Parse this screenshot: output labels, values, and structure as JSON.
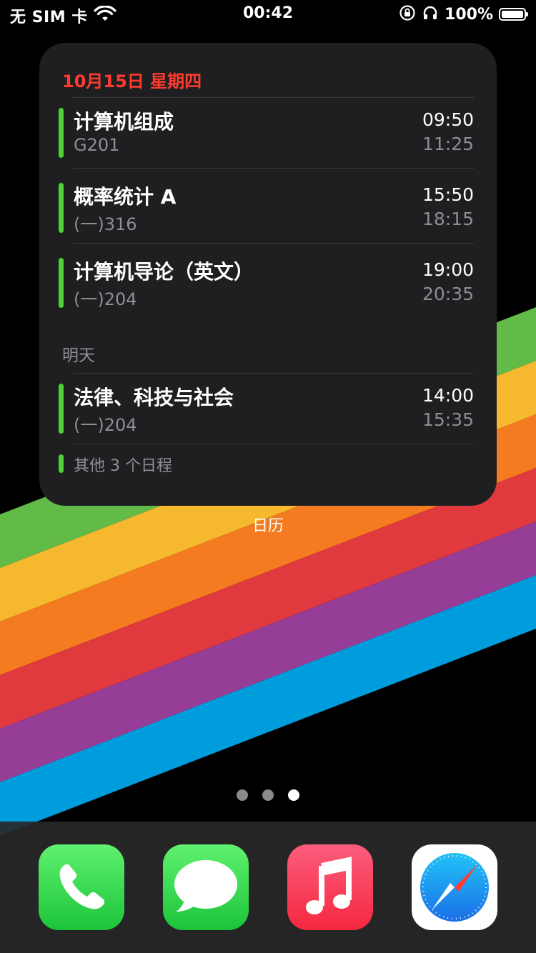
{
  "status_bar": {
    "carrier": "无 SIM 卡",
    "time": "00:42",
    "battery_percent": "100%",
    "battery_level": 1.0
  },
  "widget": {
    "app_name": "日历",
    "date_header": "10月15日 星期四",
    "today_events": [
      {
        "title": "计算机组成",
        "location": "G201",
        "start": "09:50",
        "end": "11:25"
      },
      {
        "title": "概率统计 A",
        "location": "(一)316",
        "start": "15:50",
        "end": "18:15"
      },
      {
        "title": "计算机导论（英文）",
        "location": "(一)204",
        "start": "19:00",
        "end": "20:35"
      }
    ],
    "tomorrow_label": "明天",
    "tomorrow_events": [
      {
        "title": "法律、科技与社会",
        "location": "(一)204",
        "start": "14:00",
        "end": "15:35"
      }
    ],
    "more_text": "其他 3 个日程",
    "colors": {
      "date": "#ff3b30",
      "event_bar": "#4cd137"
    }
  },
  "page_dots": {
    "count": 3,
    "active_index": 2
  },
  "dock": {
    "apps": [
      {
        "icon": "phone-icon"
      },
      {
        "icon": "messages-icon"
      },
      {
        "icon": "music-icon"
      },
      {
        "icon": "safari-icon"
      }
    ]
  },
  "wallpaper": {
    "stripe_colors": [
      "#62bb47",
      "#f5b82e",
      "#f47b20",
      "#e03a3e",
      "#963d97",
      "#009ddc"
    ]
  }
}
